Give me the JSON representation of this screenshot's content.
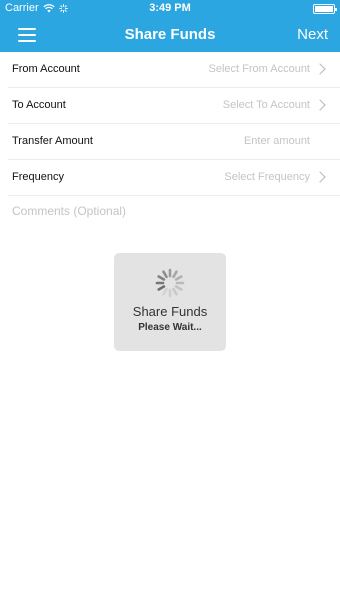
{
  "status_bar": {
    "carrier": "Carrier",
    "time": "3:49 PM"
  },
  "nav": {
    "title": "Share Funds",
    "next_label": "Next"
  },
  "form": {
    "rows": [
      {
        "label": "From Account",
        "value": "Select From Account"
      },
      {
        "label": "To Account",
        "value": "Select To Account"
      },
      {
        "label": "Transfer Amount",
        "value": "Enter amount"
      },
      {
        "label": "Frequency",
        "value": "Select Frequency"
      }
    ],
    "comments_placeholder": "Comments (Optional)"
  },
  "loading": {
    "title": "Share Funds",
    "message": "Please Wait..."
  },
  "colors": {
    "accent": "#2ba6e0"
  }
}
